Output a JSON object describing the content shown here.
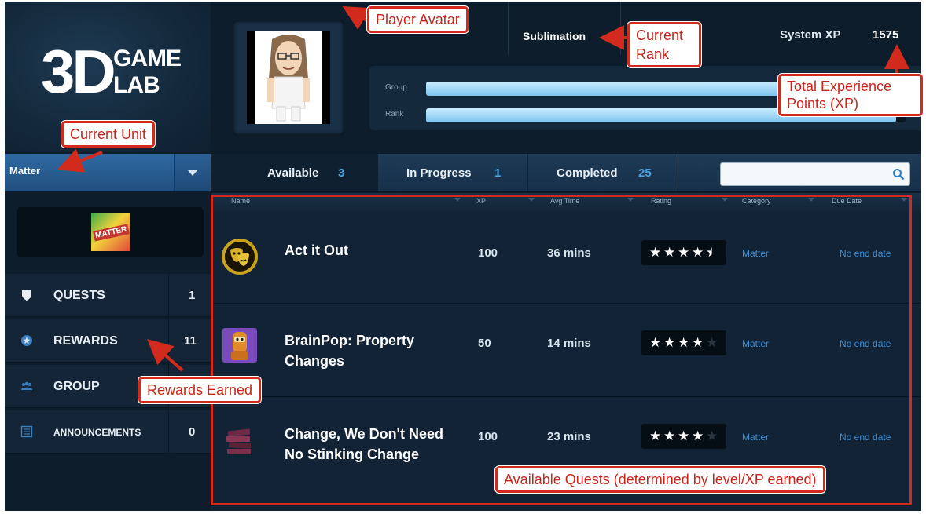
{
  "branding": {
    "logo_big": "3D",
    "logo_word1": "GAME",
    "logo_word2": "LAB"
  },
  "unit": {
    "current": "Matter",
    "badge_text": "MATTER"
  },
  "sidebar": {
    "items": [
      {
        "label": "QUESTS",
        "count": "1",
        "icon": "shield-icon"
      },
      {
        "label": "REWARDS",
        "count": "11",
        "icon": "badge-icon"
      },
      {
        "label": "GROUP",
        "count": "",
        "icon": "people-icon"
      },
      {
        "label": "ANNOUNCEMENTS",
        "count": "0",
        "icon": "list-icon"
      }
    ]
  },
  "header": {
    "rank": "Sublimation",
    "xp_label": "System XP",
    "xp_value": "1575",
    "bars": [
      {
        "label": "Group",
        "fill": 0.98
      },
      {
        "label": "Rank",
        "fill": 0.98
      }
    ]
  },
  "tabs": [
    {
      "label": "Available",
      "count": "3",
      "active": true
    },
    {
      "label": "In Progress",
      "count": "1",
      "active": false
    },
    {
      "label": "Completed",
      "count": "25",
      "active": false
    }
  ],
  "search": {
    "value": "",
    "placeholder": ""
  },
  "table": {
    "columns": [
      "Name",
      "XP",
      "Avg Time",
      "Rating",
      "Category",
      "Due Date"
    ],
    "rows": [
      {
        "name": "Act it Out",
        "xp": "100",
        "avg_time": "36 mins",
        "rating": 4.5,
        "category": "Matter",
        "due": "No end date",
        "icon": "theater-masks-icon"
      },
      {
        "name": "BrainPop: Property Changes",
        "xp": "50",
        "avg_time": "14 mins",
        "rating": 4,
        "category": "Matter",
        "due": "No end date",
        "icon": "brainpop-robot-icon"
      },
      {
        "name": "Change, We Don't Need No Stinking Change",
        "xp": "100",
        "avg_time": "23 mins",
        "rating": 4,
        "category": "Matter",
        "due": "No end date",
        "icon": "book-stack-icon"
      }
    ]
  },
  "annotations": {
    "player_avatar": "Player Avatar",
    "current_rank": "Current Rank",
    "total_xp": "Total Experience Points (XP)",
    "current_unit": "Current Unit",
    "rewards_earned": "Rewards Earned",
    "available_quests": "Available Quests (determined by level/XP earned)"
  },
  "colors": {
    "accent": "#4aa3e0",
    "annotation": "#d32a1e",
    "background": "#0e1d2b"
  }
}
